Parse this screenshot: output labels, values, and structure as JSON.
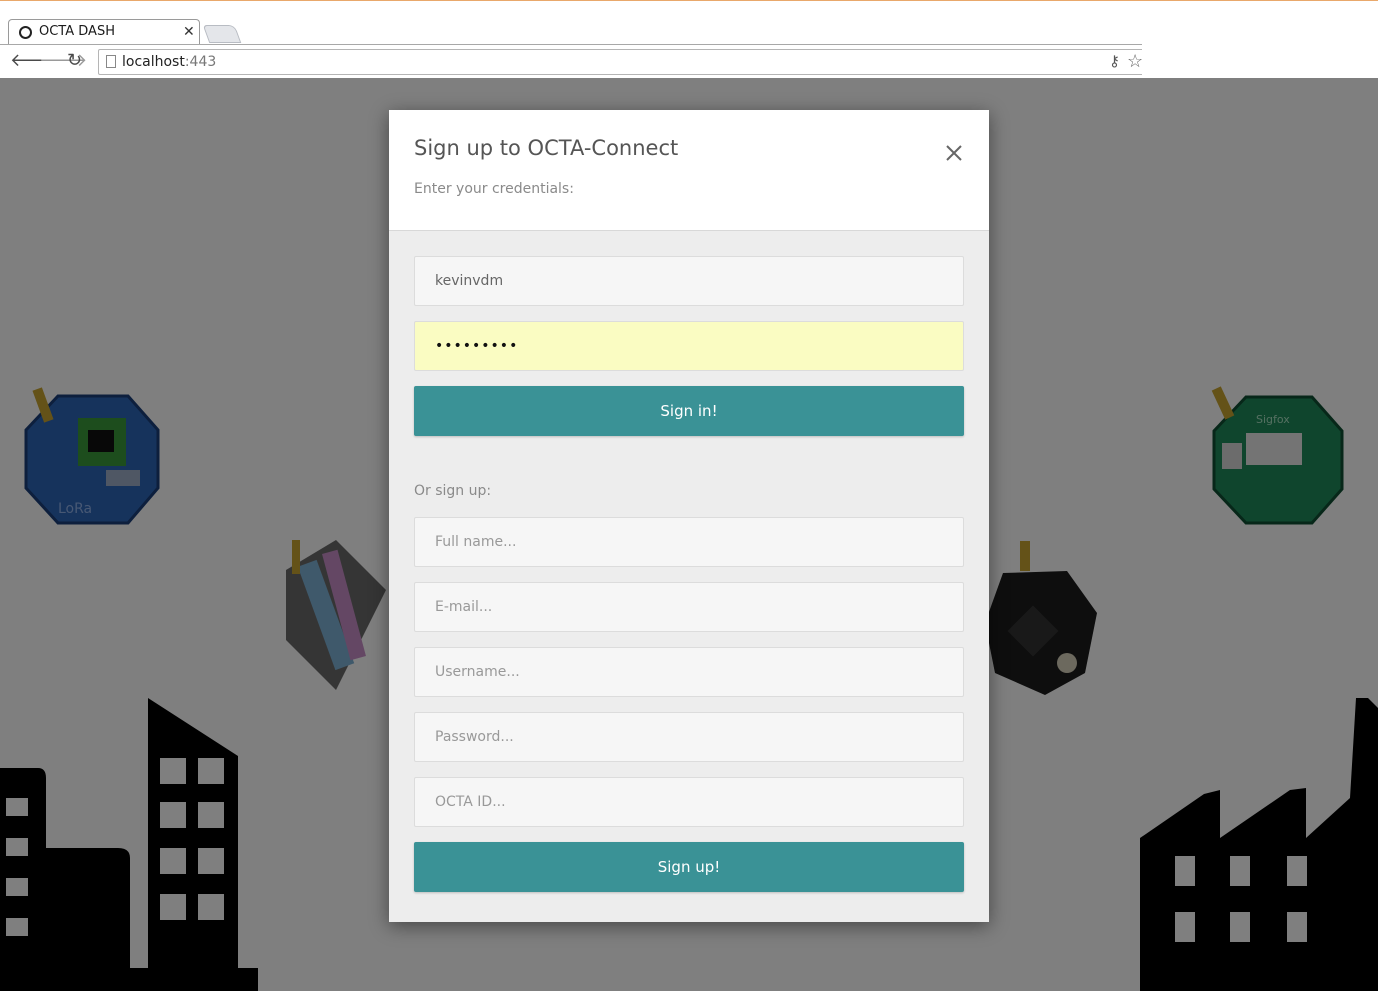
{
  "browser": {
    "tab_title": "OCTA DASH",
    "url_host": "localhost",
    "url_port": ":443"
  },
  "background": {
    "board_label_left": "LoRa",
    "board_label_right": "Sigfox"
  },
  "modal": {
    "title": "Sign up to OCTA-Connect",
    "subtitle": "Enter your credentials:",
    "signin": {
      "username_value": "kevinvdm",
      "password_value": "•••••••••",
      "button_label": "Sign in!"
    },
    "signup": {
      "section_label": "Or sign up:",
      "fullname_placeholder": "Full name...",
      "email_placeholder": "E-mail...",
      "username_placeholder": "Username...",
      "password_placeholder": "Password...",
      "octa_id_placeholder": "OCTA ID...",
      "button_label": "Sign up!"
    }
  },
  "colors": {
    "accent": "#3a9296",
    "autofill": "#fafcc2",
    "overlay": "rgba(0,0,0,0.5)"
  }
}
